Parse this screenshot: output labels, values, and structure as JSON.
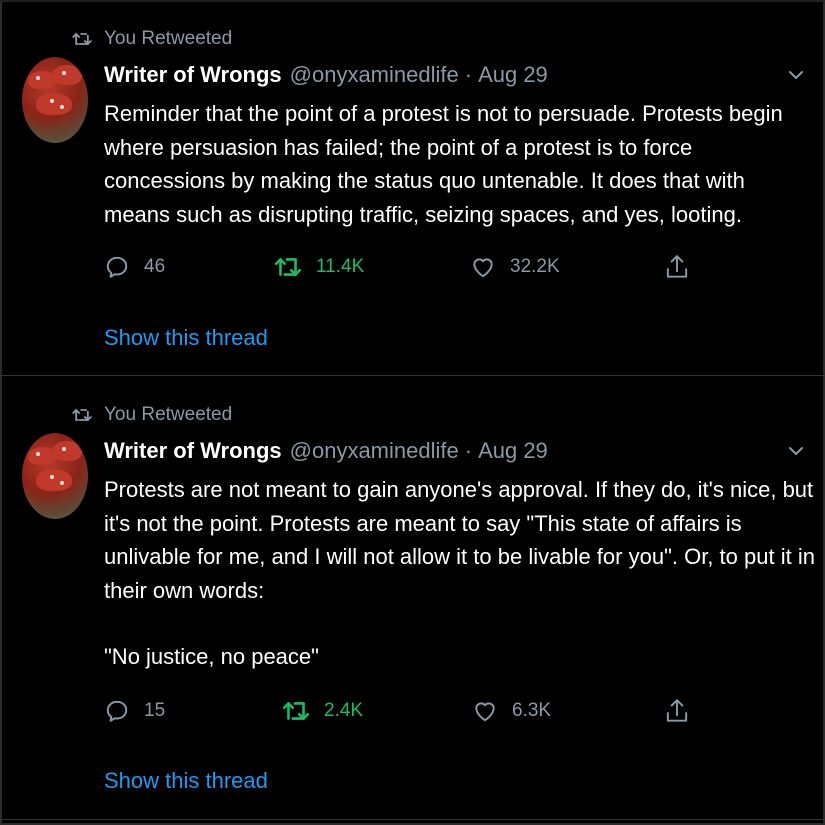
{
  "colors": {
    "background": "#000000",
    "muted": "#8b98a5",
    "retweet_active": "#17bf63",
    "link": "#1d9bf0",
    "divider": "#2f3336"
  },
  "tweets": [
    {
      "retweet_label": "You Retweeted",
      "author_name": "Writer of Wrongs",
      "handle": "@onyxaminedlife",
      "separator": "·",
      "date": "Aug 29",
      "paragraphs": [
        "Reminder that the point of a protest is not to persuade. Protests begin where persuasion has failed; the point of a protest is to force concessions by making the status quo untenable. It does that with means such as disrupting traffic, seizing spaces, and yes, looting."
      ],
      "reply_count": "46",
      "retweet_count": "11.4K",
      "like_count": "32.2K",
      "show_thread": "Show this thread",
      "icons": [
        "retweet-icon",
        "avatar",
        "chevron-down-icon",
        "reply-icon",
        "retweet-icon",
        "like-icon",
        "share-icon"
      ]
    },
    {
      "retweet_label": "You Retweeted",
      "author_name": "Writer of Wrongs",
      "handle": "@onyxaminedlife",
      "separator": "·",
      "date": "Aug 29",
      "paragraphs": [
        "Protests are not meant to gain anyone's approval. If they do, it's nice, but it's not the point. Protests are meant to say \"This state of affairs is unlivable for me, and I will not allow it to be livable for you\". Or, to put it in their own words:",
        "\"No justice, no peace\""
      ],
      "reply_count": "15",
      "retweet_count": "2.4K",
      "like_count": "6.3K",
      "show_thread": "Show this thread",
      "icons": [
        "retweet-icon",
        "avatar",
        "chevron-down-icon",
        "reply-icon",
        "retweet-icon",
        "like-icon",
        "share-icon"
      ]
    }
  ]
}
